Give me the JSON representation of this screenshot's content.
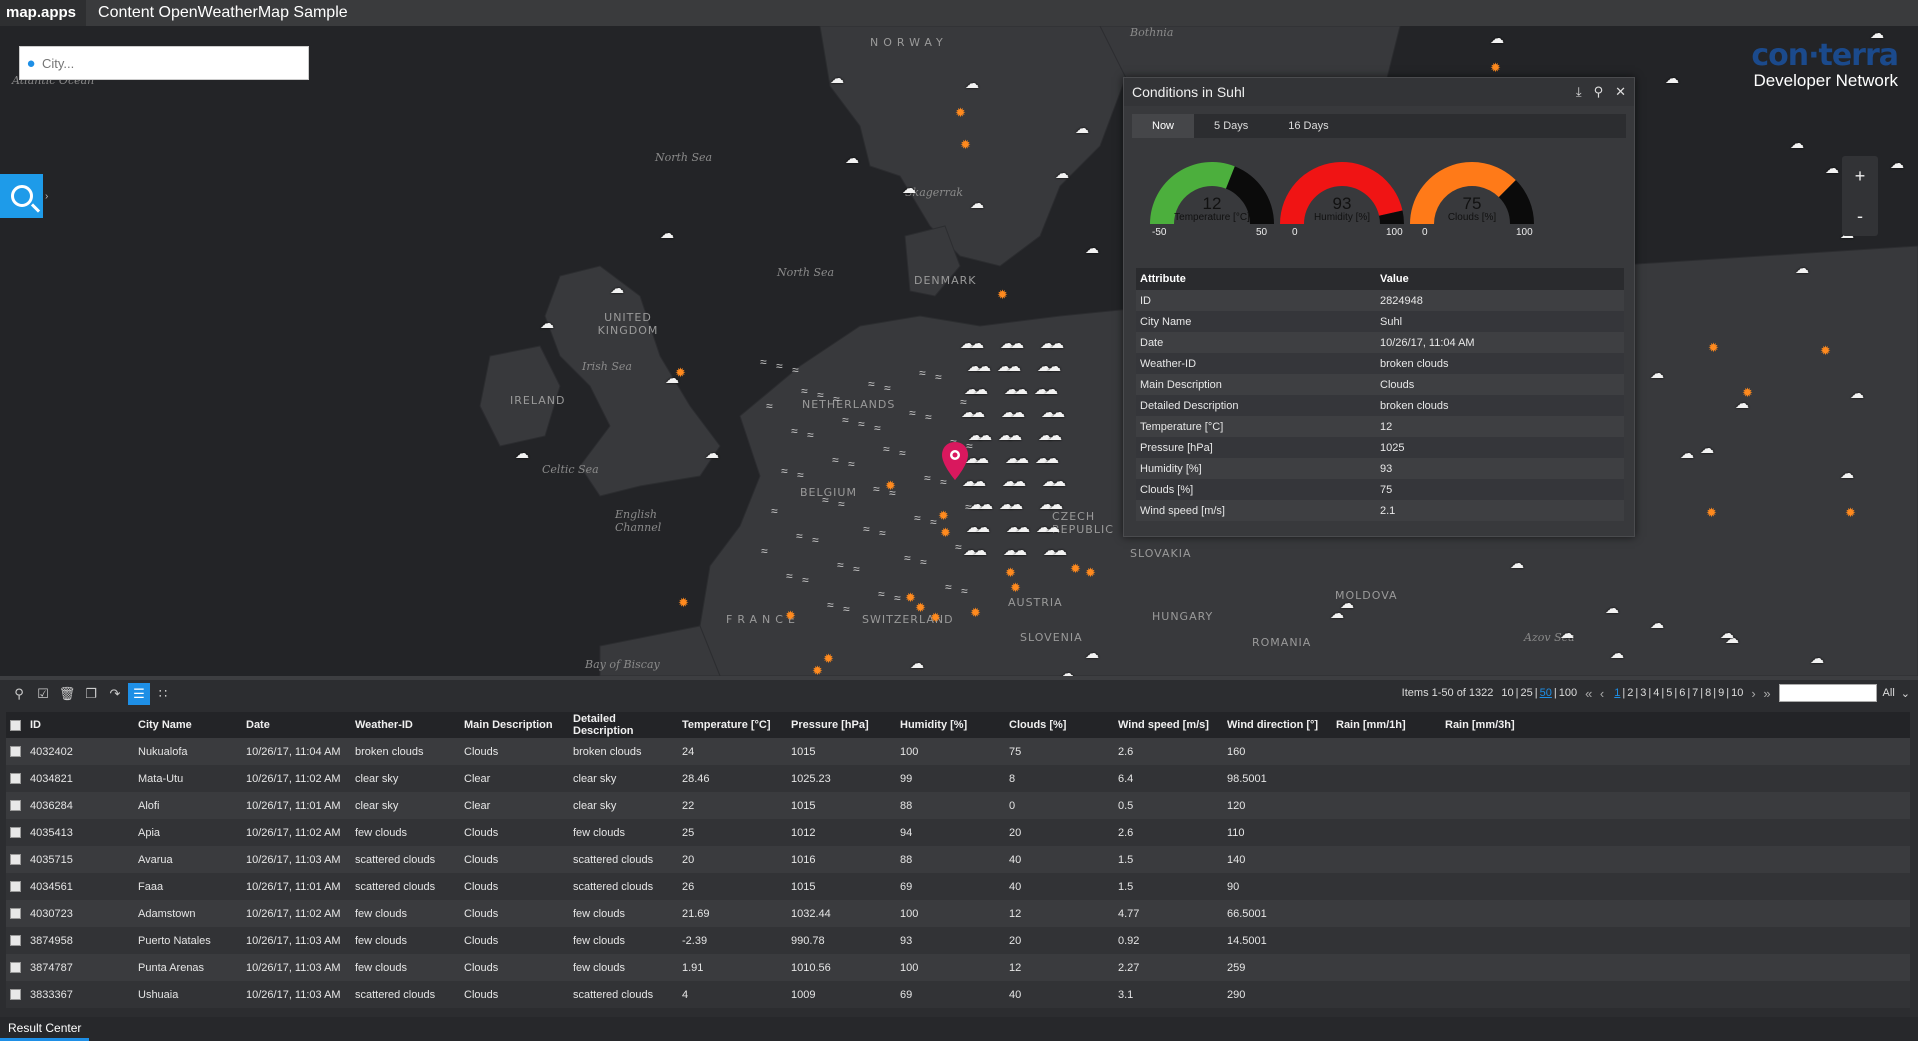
{
  "topbar": {
    "brand": "map.apps",
    "title": "Content OpenWeatherMap Sample"
  },
  "search": {
    "placeholder": "City..."
  },
  "logo": {
    "name": "con·terra",
    "subtitle": "Developer Network"
  },
  "zoom": {
    "in": "+",
    "out": "-"
  },
  "map_labels": {
    "norway": "NORWAY",
    "denmark": "DENMARK",
    "united_kingdom": "UNITED KINGDOM",
    "ireland": "IRELAND",
    "netherlands": "NETHERLANDS",
    "belgium": "BELGIUM",
    "france": "FRANCE",
    "switzerland": "SWITZERLAND",
    "austria": "AUSTRIA",
    "czech": "CZECH REPUBLIC",
    "slovakia": "SLOVAKIA",
    "hungary": "HUNGARY",
    "slovenia": "SLOVENIA",
    "romania": "ROMANIA",
    "moldova": "MOLDOVA",
    "north_sea": "North Sea",
    "north_sea2": "North Sea",
    "skagerrak": "Skagerrak",
    "irish_sea": "Irish Sea",
    "celtic_sea": "Celtic Sea",
    "english_channel": "English Channel",
    "bay_biscay": "Bay of Biscay",
    "atlantic": "Atlantic Ocean",
    "bothnia": "Bothnia",
    "azov": "Azov Sea"
  },
  "popup": {
    "title": "Conditions in Suhl",
    "tabs": [
      "Now",
      "5 Days",
      "16 Days"
    ],
    "gauges": [
      {
        "label": "Temperature [°C]",
        "value": 12,
        "min": -50,
        "max": 50,
        "color": "#4caf3d"
      },
      {
        "label": "Humidity [%]",
        "value": 93,
        "min": 0,
        "max": 100,
        "color": "#f01414"
      },
      {
        "label": "Clouds [%]",
        "value": 75,
        "min": 0,
        "max": 100,
        "color": "#ff7a18"
      }
    ],
    "table_header": {
      "attribute": "Attribute",
      "value": "Value"
    },
    "rows": [
      [
        "ID",
        "2824948"
      ],
      [
        "City Name",
        "Suhl"
      ],
      [
        "Date",
        "10/26/17, 11:04 AM"
      ],
      [
        "Weather-ID",
        "broken clouds"
      ],
      [
        "Main Description",
        "Clouds"
      ],
      [
        "Detailed Description",
        "broken clouds"
      ],
      [
        "Temperature [°C]",
        "12"
      ],
      [
        "Pressure [hPa]",
        "1025"
      ],
      [
        "Humidity [%]",
        "93"
      ],
      [
        "Clouds [%]",
        "75"
      ],
      [
        "Wind speed [m/s]",
        "2.1"
      ]
    ]
  },
  "results": {
    "items_text": "Items 1-50 of 1322",
    "page_sizes": [
      "10",
      "25",
      "50",
      "100"
    ],
    "selected_page_size": "50",
    "pages": [
      "1",
      "2",
      "3",
      "4",
      "5",
      "6",
      "7",
      "8",
      "9",
      "10"
    ],
    "current_page": "1",
    "filter_all": "All",
    "columns": [
      "ID",
      "City Name",
      "Date",
      "Weather-ID",
      "Main Description",
      "Detailed Description",
      "Temperature [°C]",
      "Pressure [hPa]",
      "Humidity [%]",
      "Clouds [%]",
      "Wind speed [m/s]",
      "Wind direction [°]",
      "Rain [mm/1h]",
      "Rain [mm/3h]"
    ],
    "rows": [
      [
        "4032402",
        "Nukualofa",
        "10/26/17, 11:04 AM",
        "broken clouds",
        "Clouds",
        "broken clouds",
        "24",
        "1015",
        "100",
        "75",
        "2.6",
        "160",
        "",
        ""
      ],
      [
        "4034821",
        "Mata-Utu",
        "10/26/17, 11:02 AM",
        "clear sky",
        "Clear",
        "clear sky",
        "28.46",
        "1025.23",
        "99",
        "8",
        "6.4",
        "98.5001",
        "",
        ""
      ],
      [
        "4036284",
        "Alofi",
        "10/26/17, 11:01 AM",
        "clear sky",
        "Clear",
        "clear sky",
        "22",
        "1015",
        "88",
        "0",
        "0.5",
        "120",
        "",
        ""
      ],
      [
        "4035413",
        "Apia",
        "10/26/17, 11:02 AM",
        "few clouds",
        "Clouds",
        "few clouds",
        "25",
        "1012",
        "94",
        "20",
        "2.6",
        "110",
        "",
        ""
      ],
      [
        "4035715",
        "Avarua",
        "10/26/17, 11:03 AM",
        "scattered clouds",
        "Clouds",
        "scattered clouds",
        "20",
        "1016",
        "88",
        "40",
        "1.5",
        "140",
        "",
        ""
      ],
      [
        "4034561",
        "Faaa",
        "10/26/17, 11:01 AM",
        "scattered clouds",
        "Clouds",
        "scattered clouds",
        "26",
        "1015",
        "69",
        "40",
        "1.5",
        "90",
        "",
        ""
      ],
      [
        "4030723",
        "Adamstown",
        "10/26/17, 11:02 AM",
        "few clouds",
        "Clouds",
        "few clouds",
        "21.69",
        "1032.44",
        "100",
        "12",
        "4.77",
        "66.5001",
        "",
        ""
      ],
      [
        "3874958",
        "Puerto Natales",
        "10/26/17, 11:03 AM",
        "few clouds",
        "Clouds",
        "few clouds",
        "-2.39",
        "990.78",
        "93",
        "20",
        "0.92",
        "14.5001",
        "",
        ""
      ],
      [
        "3874787",
        "Punta Arenas",
        "10/26/17, 11:03 AM",
        "few clouds",
        "Clouds",
        "few clouds",
        "1.91",
        "1010.56",
        "100",
        "12",
        "2.27",
        "259",
        "",
        ""
      ],
      [
        "3833367",
        "Ushuaia",
        "10/26/17, 11:03 AM",
        "scattered clouds",
        "Clouds",
        "scattered clouds",
        "4",
        "1009",
        "69",
        "40",
        "3.1",
        "290",
        "",
        ""
      ]
    ],
    "tab_label": "Result Center"
  },
  "icons": {
    "search_tool": "search-icon",
    "pin": "location-pin-icon",
    "download": "download-icon",
    "pin_window": "pin-icon",
    "close": "close-icon",
    "toolbar": [
      "zoom-to-icon",
      "select-icon",
      "delete-icon",
      "copy-icon",
      "export-icon",
      "list-view-icon",
      "grid-view-icon"
    ]
  }
}
